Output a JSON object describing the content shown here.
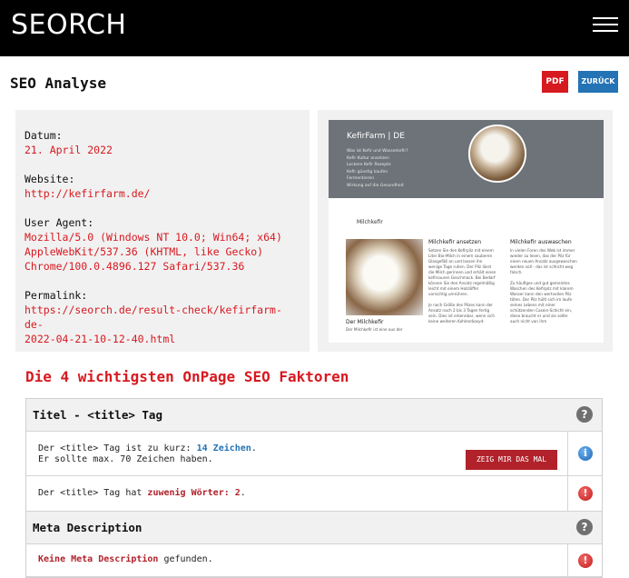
{
  "header": {
    "logo": "SEORCH",
    "menu_icon": "hamburger-menu-icon"
  },
  "page": {
    "title": "SEO Analyse",
    "pdf_label": "PDF",
    "back_label": "ZURÜCK"
  },
  "info": {
    "date_label": "Datum:",
    "date_value": "21. April 2022",
    "website_label": "Website:",
    "website_value": "http://kefirfarm.de/",
    "useragent_label": "User Agent:",
    "useragent_line1": "Mozilla/5.0 (Windows NT 10.0; Win64; x64)",
    "useragent_line2": "AppleWebKit/537.36 (KHTML, like Gecko)",
    "useragent_line3": "Chrome/100.0.4896.127 Safari/537.36",
    "permalink_label": "Permalink:",
    "permalink_line1": "https://seorch.de/result-check/kefirfarm-de-",
    "permalink_line2": "2022-04-21-10-12-40.html"
  },
  "screenshot": {
    "hero_title": "KefirFarm | DE",
    "hero_items": [
      "Was ist Kefir und Wasserkefir?",
      "Kefir Kultur ansetzen",
      "Leckere Kefir Rezepte",
      "Kefir günstig kaufen",
      "Fermentieren",
      "Wirkung auf die Gesundheit"
    ],
    "section_title": "Milchkefir",
    "img_caption": "Der Milchkefir",
    "img_caption_sub": "Der Milchkefir ist eine aus der",
    "col1_title": "Milchkefir ansetzen",
    "col1_text": [
      "Setzen Sie den Kefirpilz mit einem",
      "Liter Bio-Milch in einem sauberen",
      "Glasgefäß an und lassen ihn",
      "wenige Tage ruhen. Der Pilz lässt",
      "die Milch gerinnen und erhält einen",
      "kefirsauren Geschmack. Bei Bedarf",
      "können Sie den Ansatz regelmäßig",
      "leicht mit einem Holzlöffel",
      "vorsichtig umrühren.",
      "",
      "Je nach Größe des Pilzes kann der",
      "Ansatz nach 2 bis 3 Tagen fertig",
      "sein. Dies ist erkennbar, wenn sich",
      "keine weiteren Kohlendioxyd-"
    ],
    "col2_title": "Milchkefir auswaschen",
    "col2_text": [
      "In vielen Foren des Web ist immer",
      "wieder zu lesen, das der Pilz für",
      "einen neuen Ansatz ausgewaschen",
      "werden soll - das ist schlicht weg",
      "falsch.",
      "",
      "Zu häufiges und gut gemeintes",
      "Waschen des Kefirpilz mit klarem",
      "Wasser kann den wertvollen Pilz",
      "töten. Der Pilz hüllt sich im laufe",
      "seines Lebens mit einer",
      "schützenden Casein-Schicht ein,",
      "diese braucht er und sie sollte",
      "auch nicht von ihm"
    ]
  },
  "factors": {
    "heading": "Die 4 wichtigsten OnPage SEO Faktoren",
    "title_tag": {
      "header": "Titel - <title> Tag",
      "check1_pre": "Der <title> Tag ist zu kurz: ",
      "check1_count": "14 Zeichen",
      "check1_post": ".",
      "check1_line2": "Er sollte max. 70 Zeichen haben.",
      "show_button": "ZEIG MIR DAS MAL",
      "check2_pre": "Der <title> Tag hat ",
      "check2_hl": "zuwenig Wörter: 2",
      "check2_post": "."
    },
    "meta_desc": {
      "header": "Meta Description",
      "check1_hl": "Keine Meta Description",
      "check1_post": " gefunden."
    },
    "help_icon_text": "?",
    "info_icon_text": "i",
    "error_icon_text": "!"
  }
}
